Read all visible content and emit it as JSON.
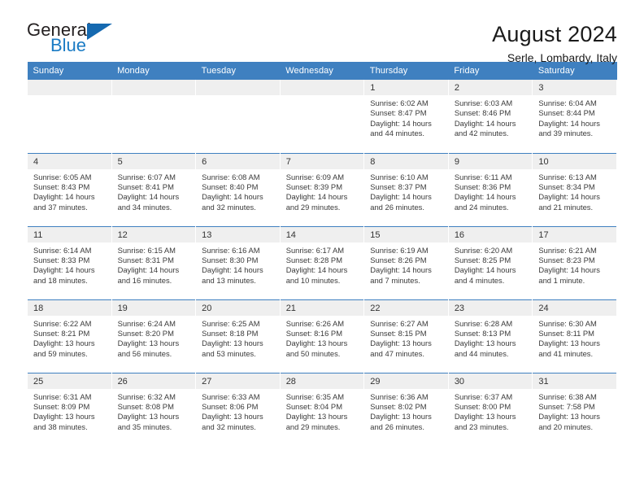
{
  "brand": {
    "name_top": "General",
    "name_bottom": "Blue",
    "triangle_color": "#1569b0",
    "blue_color": "#1a7bc4"
  },
  "header": {
    "title": "August 2024",
    "subtitle": "Serle, Lombardy, Italy"
  },
  "theme": {
    "header_bg": "#3f80c0",
    "daynum_bg": "#efefef",
    "grid_line": "#3f80c0"
  },
  "weekday_headers": [
    "Sunday",
    "Monday",
    "Tuesday",
    "Wednesday",
    "Thursday",
    "Friday",
    "Saturday"
  ],
  "weeks": [
    [
      {
        "day": "",
        "empty": true,
        "sunrise": "",
        "sunset": "",
        "daylight": ""
      },
      {
        "day": "",
        "empty": true,
        "sunrise": "",
        "sunset": "",
        "daylight": ""
      },
      {
        "day": "",
        "empty": true,
        "sunrise": "",
        "sunset": "",
        "daylight": ""
      },
      {
        "day": "",
        "empty": true,
        "sunrise": "",
        "sunset": "",
        "daylight": ""
      },
      {
        "day": "1",
        "sunrise": "Sunrise: 6:02 AM",
        "sunset": "Sunset: 8:47 PM",
        "daylight": "Daylight: 14 hours and 44 minutes."
      },
      {
        "day": "2",
        "sunrise": "Sunrise: 6:03 AM",
        "sunset": "Sunset: 8:46 PM",
        "daylight": "Daylight: 14 hours and 42 minutes."
      },
      {
        "day": "3",
        "sunrise": "Sunrise: 6:04 AM",
        "sunset": "Sunset: 8:44 PM",
        "daylight": "Daylight: 14 hours and 39 minutes."
      }
    ],
    [
      {
        "day": "4",
        "sunrise": "Sunrise: 6:05 AM",
        "sunset": "Sunset: 8:43 PM",
        "daylight": "Daylight: 14 hours and 37 minutes."
      },
      {
        "day": "5",
        "sunrise": "Sunrise: 6:07 AM",
        "sunset": "Sunset: 8:41 PM",
        "daylight": "Daylight: 14 hours and 34 minutes."
      },
      {
        "day": "6",
        "sunrise": "Sunrise: 6:08 AM",
        "sunset": "Sunset: 8:40 PM",
        "daylight": "Daylight: 14 hours and 32 minutes."
      },
      {
        "day": "7",
        "sunrise": "Sunrise: 6:09 AM",
        "sunset": "Sunset: 8:39 PM",
        "daylight": "Daylight: 14 hours and 29 minutes."
      },
      {
        "day": "8",
        "sunrise": "Sunrise: 6:10 AM",
        "sunset": "Sunset: 8:37 PM",
        "daylight": "Daylight: 14 hours and 26 minutes."
      },
      {
        "day": "9",
        "sunrise": "Sunrise: 6:11 AM",
        "sunset": "Sunset: 8:36 PM",
        "daylight": "Daylight: 14 hours and 24 minutes."
      },
      {
        "day": "10",
        "sunrise": "Sunrise: 6:13 AM",
        "sunset": "Sunset: 8:34 PM",
        "daylight": "Daylight: 14 hours and 21 minutes."
      }
    ],
    [
      {
        "day": "11",
        "sunrise": "Sunrise: 6:14 AM",
        "sunset": "Sunset: 8:33 PM",
        "daylight": "Daylight: 14 hours and 18 minutes."
      },
      {
        "day": "12",
        "sunrise": "Sunrise: 6:15 AM",
        "sunset": "Sunset: 8:31 PM",
        "daylight": "Daylight: 14 hours and 16 minutes."
      },
      {
        "day": "13",
        "sunrise": "Sunrise: 6:16 AM",
        "sunset": "Sunset: 8:30 PM",
        "daylight": "Daylight: 14 hours and 13 minutes."
      },
      {
        "day": "14",
        "sunrise": "Sunrise: 6:17 AM",
        "sunset": "Sunset: 8:28 PM",
        "daylight": "Daylight: 14 hours and 10 minutes."
      },
      {
        "day": "15",
        "sunrise": "Sunrise: 6:19 AM",
        "sunset": "Sunset: 8:26 PM",
        "daylight": "Daylight: 14 hours and 7 minutes."
      },
      {
        "day": "16",
        "sunrise": "Sunrise: 6:20 AM",
        "sunset": "Sunset: 8:25 PM",
        "daylight": "Daylight: 14 hours and 4 minutes."
      },
      {
        "day": "17",
        "sunrise": "Sunrise: 6:21 AM",
        "sunset": "Sunset: 8:23 PM",
        "daylight": "Daylight: 14 hours and 1 minute."
      }
    ],
    [
      {
        "day": "18",
        "sunrise": "Sunrise: 6:22 AM",
        "sunset": "Sunset: 8:21 PM",
        "daylight": "Daylight: 13 hours and 59 minutes."
      },
      {
        "day": "19",
        "sunrise": "Sunrise: 6:24 AM",
        "sunset": "Sunset: 8:20 PM",
        "daylight": "Daylight: 13 hours and 56 minutes."
      },
      {
        "day": "20",
        "sunrise": "Sunrise: 6:25 AM",
        "sunset": "Sunset: 8:18 PM",
        "daylight": "Daylight: 13 hours and 53 minutes."
      },
      {
        "day": "21",
        "sunrise": "Sunrise: 6:26 AM",
        "sunset": "Sunset: 8:16 PM",
        "daylight": "Daylight: 13 hours and 50 minutes."
      },
      {
        "day": "22",
        "sunrise": "Sunrise: 6:27 AM",
        "sunset": "Sunset: 8:15 PM",
        "daylight": "Daylight: 13 hours and 47 minutes."
      },
      {
        "day": "23",
        "sunrise": "Sunrise: 6:28 AM",
        "sunset": "Sunset: 8:13 PM",
        "daylight": "Daylight: 13 hours and 44 minutes."
      },
      {
        "day": "24",
        "sunrise": "Sunrise: 6:30 AM",
        "sunset": "Sunset: 8:11 PM",
        "daylight": "Daylight: 13 hours and 41 minutes."
      }
    ],
    [
      {
        "day": "25",
        "sunrise": "Sunrise: 6:31 AM",
        "sunset": "Sunset: 8:09 PM",
        "daylight": "Daylight: 13 hours and 38 minutes."
      },
      {
        "day": "26",
        "sunrise": "Sunrise: 6:32 AM",
        "sunset": "Sunset: 8:08 PM",
        "daylight": "Daylight: 13 hours and 35 minutes."
      },
      {
        "day": "27",
        "sunrise": "Sunrise: 6:33 AM",
        "sunset": "Sunset: 8:06 PM",
        "daylight": "Daylight: 13 hours and 32 minutes."
      },
      {
        "day": "28",
        "sunrise": "Sunrise: 6:35 AM",
        "sunset": "Sunset: 8:04 PM",
        "daylight": "Daylight: 13 hours and 29 minutes."
      },
      {
        "day": "29",
        "sunrise": "Sunrise: 6:36 AM",
        "sunset": "Sunset: 8:02 PM",
        "daylight": "Daylight: 13 hours and 26 minutes."
      },
      {
        "day": "30",
        "sunrise": "Sunrise: 6:37 AM",
        "sunset": "Sunset: 8:00 PM",
        "daylight": "Daylight: 13 hours and 23 minutes."
      },
      {
        "day": "31",
        "sunrise": "Sunrise: 6:38 AM",
        "sunset": "Sunset: 7:58 PM",
        "daylight": "Daylight: 13 hours and 20 minutes."
      }
    ]
  ]
}
